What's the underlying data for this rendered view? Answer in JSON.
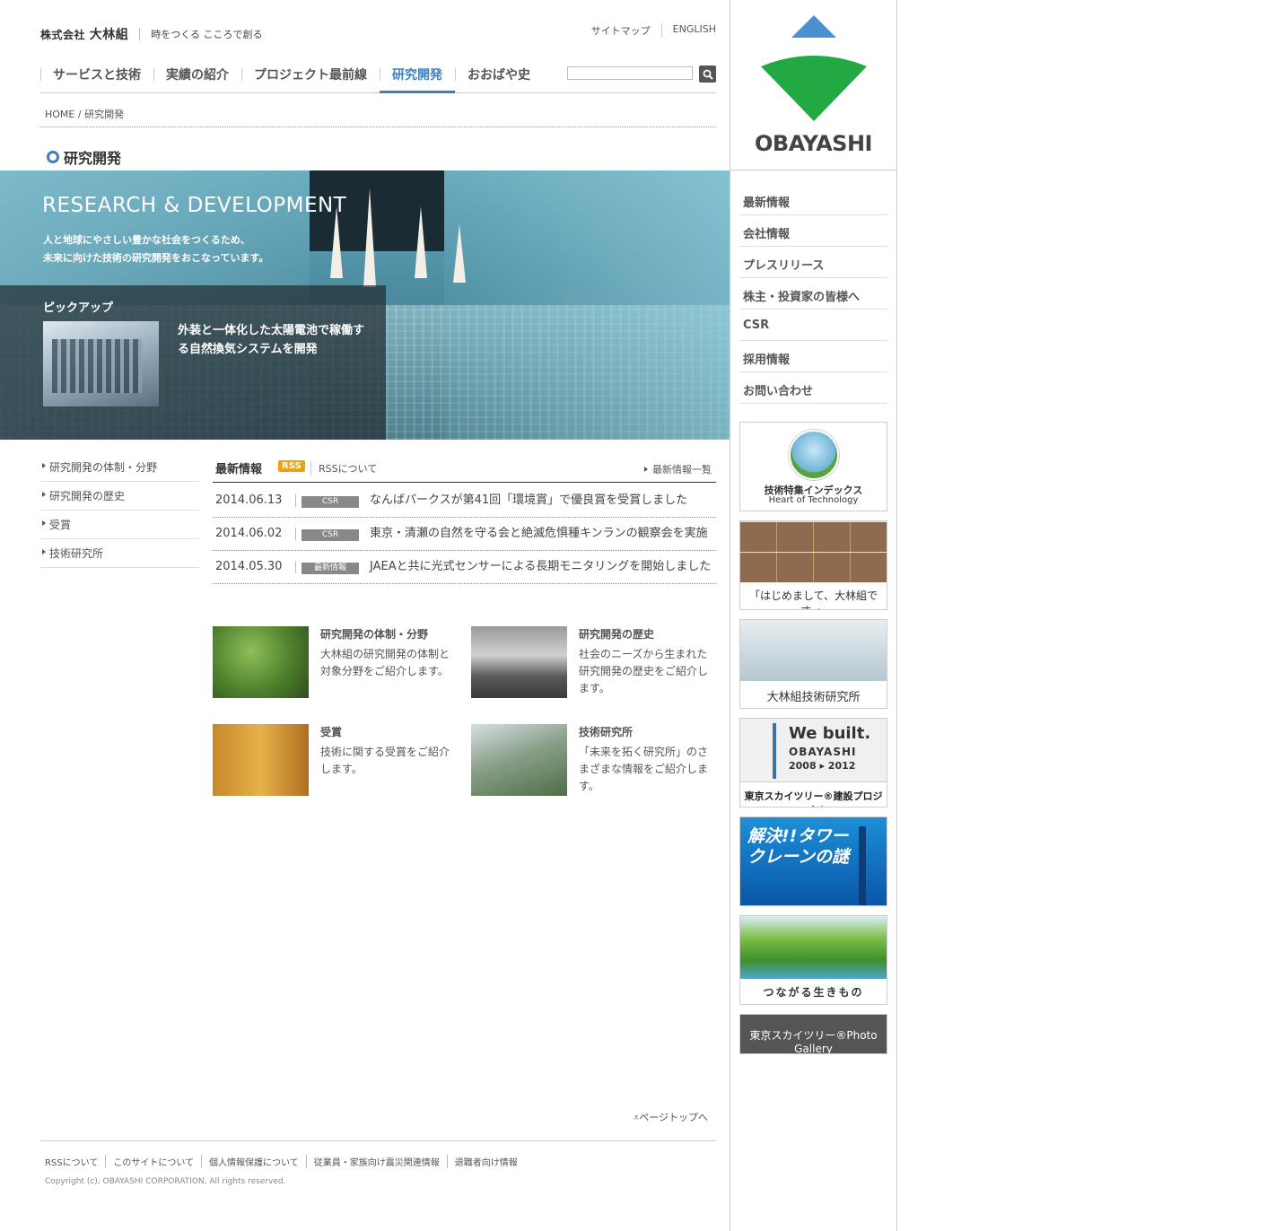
{
  "header": {
    "company_prefix": "株式会社",
    "company_name": "大林組",
    "tagline": "時をつくる こころで創る",
    "util_links": [
      "サイトマップ",
      "ENGLISH"
    ],
    "nav": [
      "サービスと技術",
      "実績の紹介",
      "プロジェクト最前線",
      "研究開発",
      "おおばや史"
    ],
    "nav_active": "研究開発",
    "search_placeholder": ""
  },
  "breadcrumb": {
    "home": "HOME",
    "separator": " / ",
    "current": "研究開発"
  },
  "page_title": "研究開発",
  "hero": {
    "title": "RESEARCH & DEVELOPMENT",
    "lead_1": "人と地球にやさしい豊かな社会をつくるため、",
    "lead_2": "未来に向けた技術の研究開発をおこなっています。",
    "pickup_label": "ピックアップ",
    "pickup_text": "外装と一体化した太陽電池で稼働する自然換気システムを開発"
  },
  "subnav": [
    "研究開発の体制・分野",
    "研究開発の歴史",
    "受賞",
    "技術研究所"
  ],
  "news": {
    "title": "最新情報",
    "rss_badge": "RSS",
    "rss_about": "RSSについて",
    "all_link": "最新情報一覧",
    "items": [
      {
        "date": "2014.06.13",
        "category": "CSR",
        "text": "なんばパークスが第41回「環境賞」で優良賞を受賞しました"
      },
      {
        "date": "2014.06.02",
        "category": "CSR",
        "text": "東京・清瀬の自然を守る会と絶滅危惧種キンランの観察会を実施"
      },
      {
        "date": "2014.05.30",
        "category": "最新情報",
        "text": "JAEAと共に光式センサーによる長期モニタリングを開始しました"
      }
    ]
  },
  "cards": [
    {
      "title": "研究開発の体制・分野",
      "desc": "大林組の研究開発の体制と対象分野をご紹介します。"
    },
    {
      "title": "研究開発の歴史",
      "desc": "社会のニーズから生まれた研究開発の歴史をご紹介します。"
    },
    {
      "title": "受賞",
      "desc": "技術に関する受賞をご紹介します。"
    },
    {
      "title": "技術研究所",
      "desc": "「未来を拓く研究所」のさまざまな情報をご紹介します。"
    }
  ],
  "pagetop": "ページトップへ",
  "footer": {
    "links": [
      "RSSについて",
      "このサイトについて",
      "個人情報保護について",
      "従業員・家族向け震災関連情報",
      "退職者向け情報"
    ],
    "copyright": "Copyright (c), OBAYASHI CORPORATION, All rights reserved."
  },
  "sidebar": {
    "logo_text": "OBAYASHI",
    "nav": [
      "最新情報",
      "会社情報",
      "プレスリリース",
      "株主・投資家の皆様へ",
      "CSR",
      "採用情報",
      "お問い合わせ"
    ],
    "banners": {
      "tech_index_1": "技術特集インデックス",
      "tech_index_2": "Heart of Technology",
      "hajimemashite": "「はじめまして、大林組です。」",
      "lab": "大林組技術研究所",
      "we_built": "We built.",
      "obayashi": "OBAYASHI",
      "years": "2008 ▸ 2012",
      "skytree_project": "東京スカイツリー®建設プロジェクト",
      "crane": "解決!!タワークレーンの謎",
      "ikimono": "つながる生きもの",
      "photo_gallery": "東京スカイツリー®Photo Gallery"
    }
  },
  "colors": {
    "accent": "#3f7fc0",
    "logo_green": "#22a944",
    "logo_blue": "#4a90d0",
    "rss": "#e8a317"
  }
}
